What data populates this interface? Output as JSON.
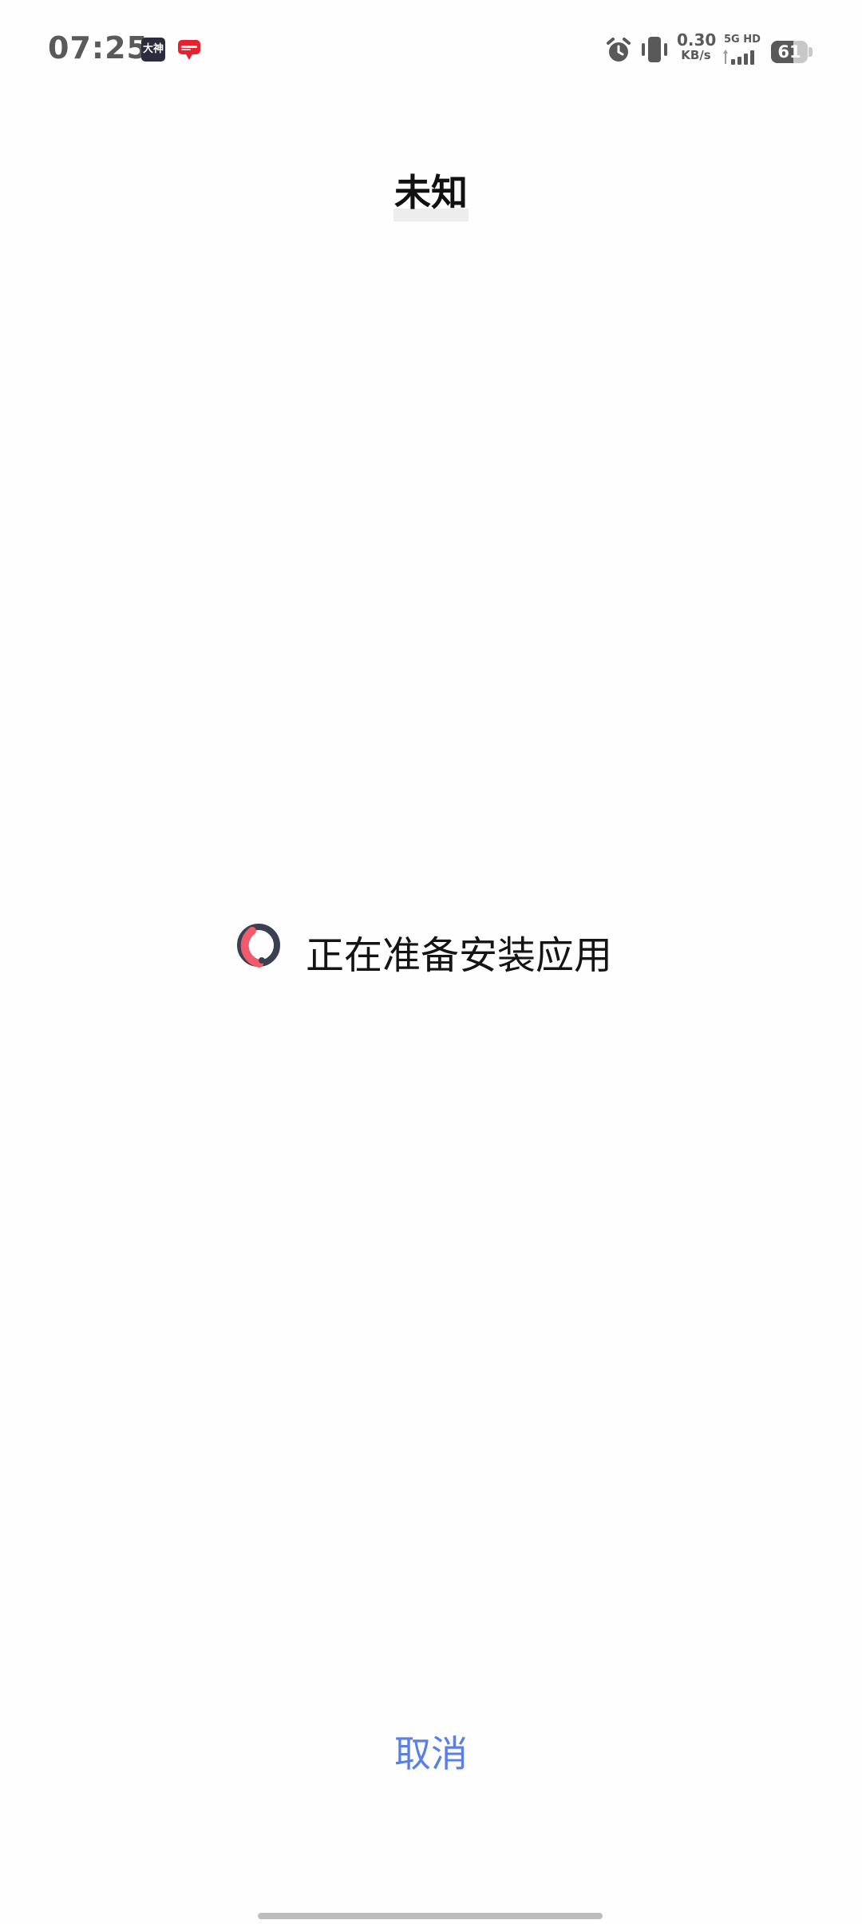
{
  "status_bar": {
    "time": "07:25",
    "notification_icons": [
      "dashen-app-icon",
      "red-app-icon"
    ],
    "dashen_label": "大神",
    "net_speed_value": "0.30",
    "net_speed_unit": "KB/s",
    "signal_label": "5G HD",
    "battery_level": "61",
    "battery_percent": 61
  },
  "title": "未知",
  "progress": {
    "text": "正在准备安装应用",
    "spinner_colors": {
      "track": "#3c3f52",
      "accent": "#f25c6a"
    }
  },
  "actions": {
    "cancel_label": "取消",
    "cancel_color": "#5a80e6"
  }
}
